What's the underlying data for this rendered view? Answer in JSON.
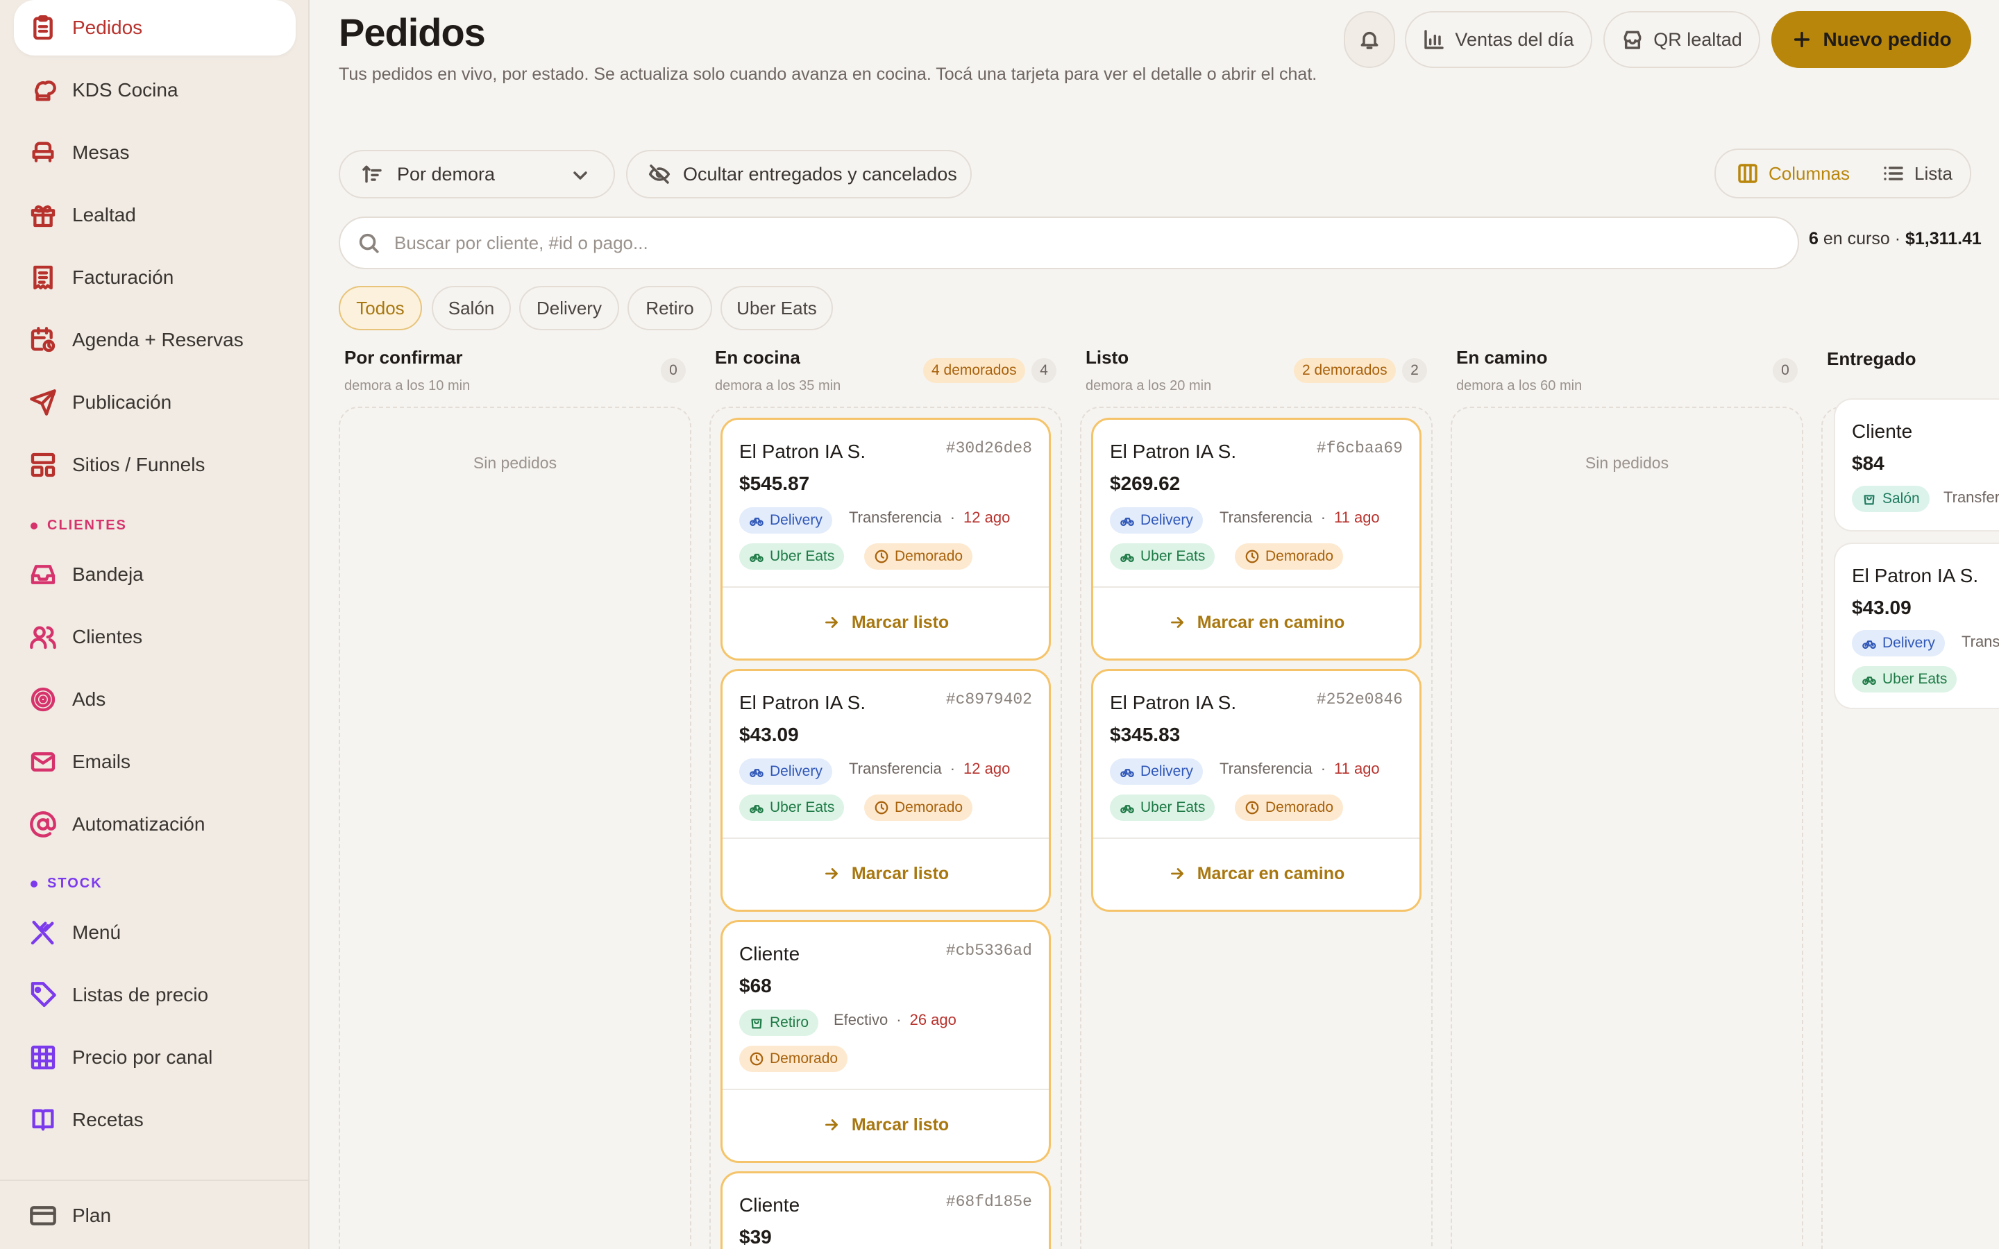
{
  "sidebar": {
    "items": [
      {
        "label": "Pedidos",
        "icon": "clipboard-icon"
      },
      {
        "label": "KDS Cocina",
        "icon": "chef-hat-icon"
      },
      {
        "label": "Mesas",
        "icon": "armchair-icon"
      },
      {
        "label": "Lealtad",
        "icon": "gift-icon"
      },
      {
        "label": "Facturación",
        "icon": "receipt-icon"
      },
      {
        "label": "Agenda + Reservas",
        "icon": "calendar-clock-icon"
      },
      {
        "label": "Publicación",
        "icon": "send-icon"
      },
      {
        "label": "Sitios / Funnels",
        "icon": "layout-icon"
      }
    ],
    "section_clientes": "CLIENTES",
    "clientes_items": [
      {
        "label": "Bandeja",
        "icon": "inbox-icon"
      },
      {
        "label": "Clientes",
        "icon": "users-icon"
      },
      {
        "label": "Ads",
        "icon": "target-icon"
      },
      {
        "label": "Emails",
        "icon": "mail-icon"
      },
      {
        "label": "Automatización",
        "icon": "at-sign-icon"
      }
    ],
    "section_stock": "STOCK",
    "stock_items": [
      {
        "label": "Menú",
        "icon": "utensils-icon"
      },
      {
        "label": "Listas de precio",
        "icon": "tag-icon"
      },
      {
        "label": "Precio por canal",
        "icon": "grid-icon"
      },
      {
        "label": "Recetas",
        "icon": "book-icon"
      }
    ],
    "plan_label": "Plan",
    "colors": {
      "active": "#b8322d",
      "clientes_dot": "#d6336c",
      "stock_dot": "#7c3aed"
    }
  },
  "header": {
    "title": "Pedidos",
    "subtitle": "Tus pedidos en vivo, por estado. Se actualiza solo cuando avanza en cocina. Tocá una tarjeta para ver el detalle o abrir el chat.",
    "ventas_label": "Ventas del día",
    "qr_label": "QR lealtad",
    "nuevo_label": "Nuevo pedido"
  },
  "toolbar": {
    "sort_value": "Por demora",
    "hide_label": "Ocultar entregados y cancelados",
    "view_columns": "Columnas",
    "view_list": "Lista"
  },
  "search": {
    "placeholder": "Buscar por cliente, #id o pago...",
    "summary_count": "6",
    "summary_text": "en curso ·",
    "summary_total": "$1,311.41"
  },
  "filters": [
    "Todos",
    "Salón",
    "Delivery",
    "Retiro",
    "Uber Eats"
  ],
  "columns": [
    {
      "title": "Por confirmar",
      "sub": "demora a los 10 min",
      "count": "0",
      "late": "",
      "empty": "Sin pedidos"
    },
    {
      "title": "En cocina",
      "sub": "demora a los 35 min",
      "count": "4",
      "late": "4 demorados",
      "empty": ""
    },
    {
      "title": "Listo",
      "sub": "demora a los 20 min",
      "count": "2",
      "late": "2 demorados",
      "empty": ""
    },
    {
      "title": "En camino",
      "sub": "demora a los 60 min",
      "count": "0",
      "late": "",
      "empty": "Sin pedidos"
    },
    {
      "title": "Entregado",
      "sub": "",
      "count": "",
      "late": "",
      "empty": ""
    }
  ],
  "cards": {
    "cocina": [
      {
        "name": "El Patron IA S.",
        "id": "#30d26de8",
        "amount": "$545.87",
        "channel": "Delivery",
        "pay": "Transferencia",
        "ago": "12 ago",
        "platform": "Uber Eats",
        "late": "Demorado",
        "action": "Marcar listo"
      },
      {
        "name": "El Patron IA S.",
        "id": "#c8979402",
        "amount": "$43.09",
        "channel": "Delivery",
        "pay": "Transferencia",
        "ago": "12 ago",
        "platform": "Uber Eats",
        "late": "Demorado",
        "action": "Marcar listo"
      },
      {
        "name": "Cliente",
        "id": "#cb5336ad",
        "amount": "$68",
        "channel": "Retiro",
        "pay": "Efectivo",
        "ago": "26 ago",
        "late": "Demorado",
        "action": "Marcar listo"
      },
      {
        "name": "Cliente",
        "id": "#68fd185e",
        "amount": "$39"
      }
    ],
    "listo": [
      {
        "name": "El Patron IA S.",
        "id": "#f6cbaa69",
        "amount": "$269.62",
        "channel": "Delivery",
        "pay": "Transferencia",
        "ago": "11 ago",
        "platform": "Uber Eats",
        "late": "Demorado",
        "action": "Marcar en camino"
      },
      {
        "name": "El Patron IA S.",
        "id": "#252e0846",
        "amount": "$345.83",
        "channel": "Delivery",
        "pay": "Transferencia",
        "ago": "11 ago",
        "platform": "Uber Eats",
        "late": "Demorado",
        "action": "Marcar en camino"
      }
    ],
    "entregado": [
      {
        "name": "Cliente",
        "amount": "$84",
        "channel": "Salón",
        "pay": "Transfer"
      },
      {
        "name": "El Patron IA S.",
        "amount": "$43.09",
        "channel": "Delivery",
        "pay": "Trans",
        "platform": "Uber Eats"
      }
    ]
  },
  "colors": {
    "accent": "#b8860b",
    "late": "#a8620c",
    "delivery": "#2f57b8",
    "ubereats": "#1e7a46"
  }
}
